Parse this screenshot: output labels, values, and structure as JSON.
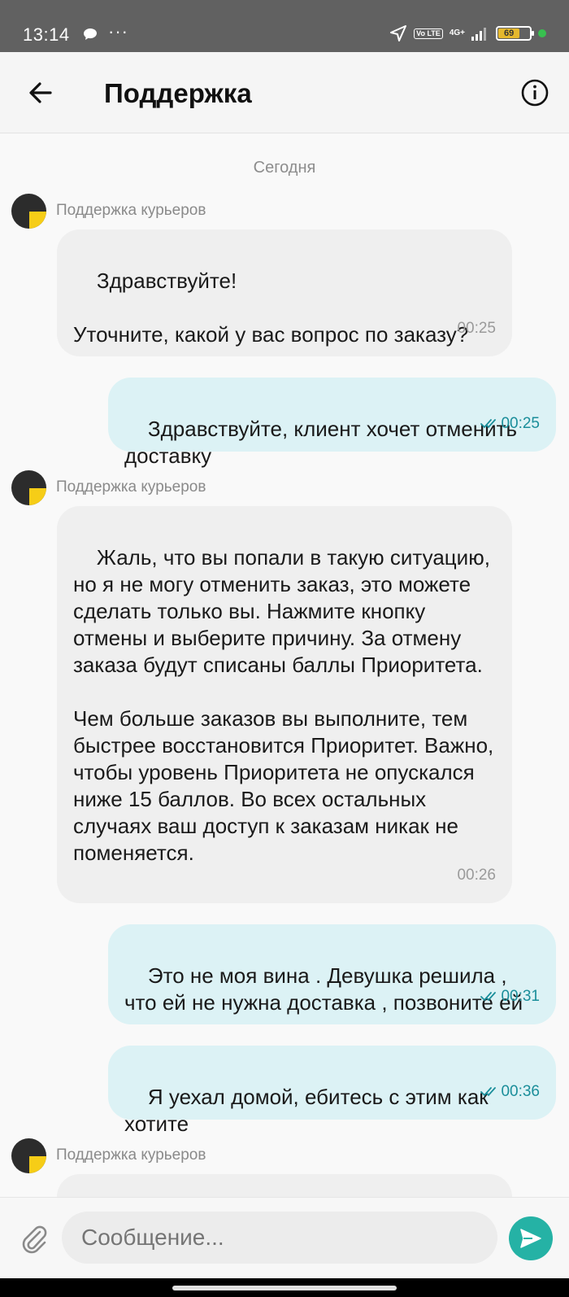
{
  "status": {
    "time": "13:14",
    "dots": "···",
    "volte": "Vo LTE",
    "net": "4G+",
    "battery": "69"
  },
  "header": {
    "title": "Поддержка"
  },
  "chat": {
    "date": "Сегодня",
    "sender_name": "Поддержка курьеров",
    "messages": [
      {
        "text": "Здравствуйте!\n\nУточните, какой у вас вопрос по заказу?",
        "time": "00:25"
      },
      {
        "text": "Здравствуйте, клиент хочет отменить доставку",
        "time": "00:25"
      },
      {
        "text": "Жаль, что вы попали в такую ситуацию, но я не могу отменить заказ, это можете сделать только вы. Нажмите кнопку отмены и выберите причину. За отмену заказа будут списаны баллы Приоритета.\n\nЧем больше заказов вы выполните, тем быстрее восстановится Приоритет. Важно, чтобы уровень Приоритета не опускался ниже 15 баллов. Во всех остальных случаях ваш доступ к заказам никак не поменяется.",
        "time": "00:26"
      },
      {
        "text": "Это не моя вина . Девушка решила , что ей не нужна доставка , позвоните ей",
        "time": "00:31"
      },
      {
        "text": "Я уехал домой, ебитесь с этим как хотите",
        "time": "00:36"
      }
    ]
  },
  "composer": {
    "placeholder": "Сообщение..."
  },
  "colors": {
    "statusbar": "#616161",
    "incoming_bubble": "#efefef",
    "outgoing_bubble": "#dcf2f5",
    "accent": "#25b2a5",
    "avatar_yellow": "#f6cd17"
  },
  "icons": [
    "back-arrow-icon",
    "info-icon",
    "paperclip-icon",
    "send-icon",
    "double-check-icon"
  ]
}
